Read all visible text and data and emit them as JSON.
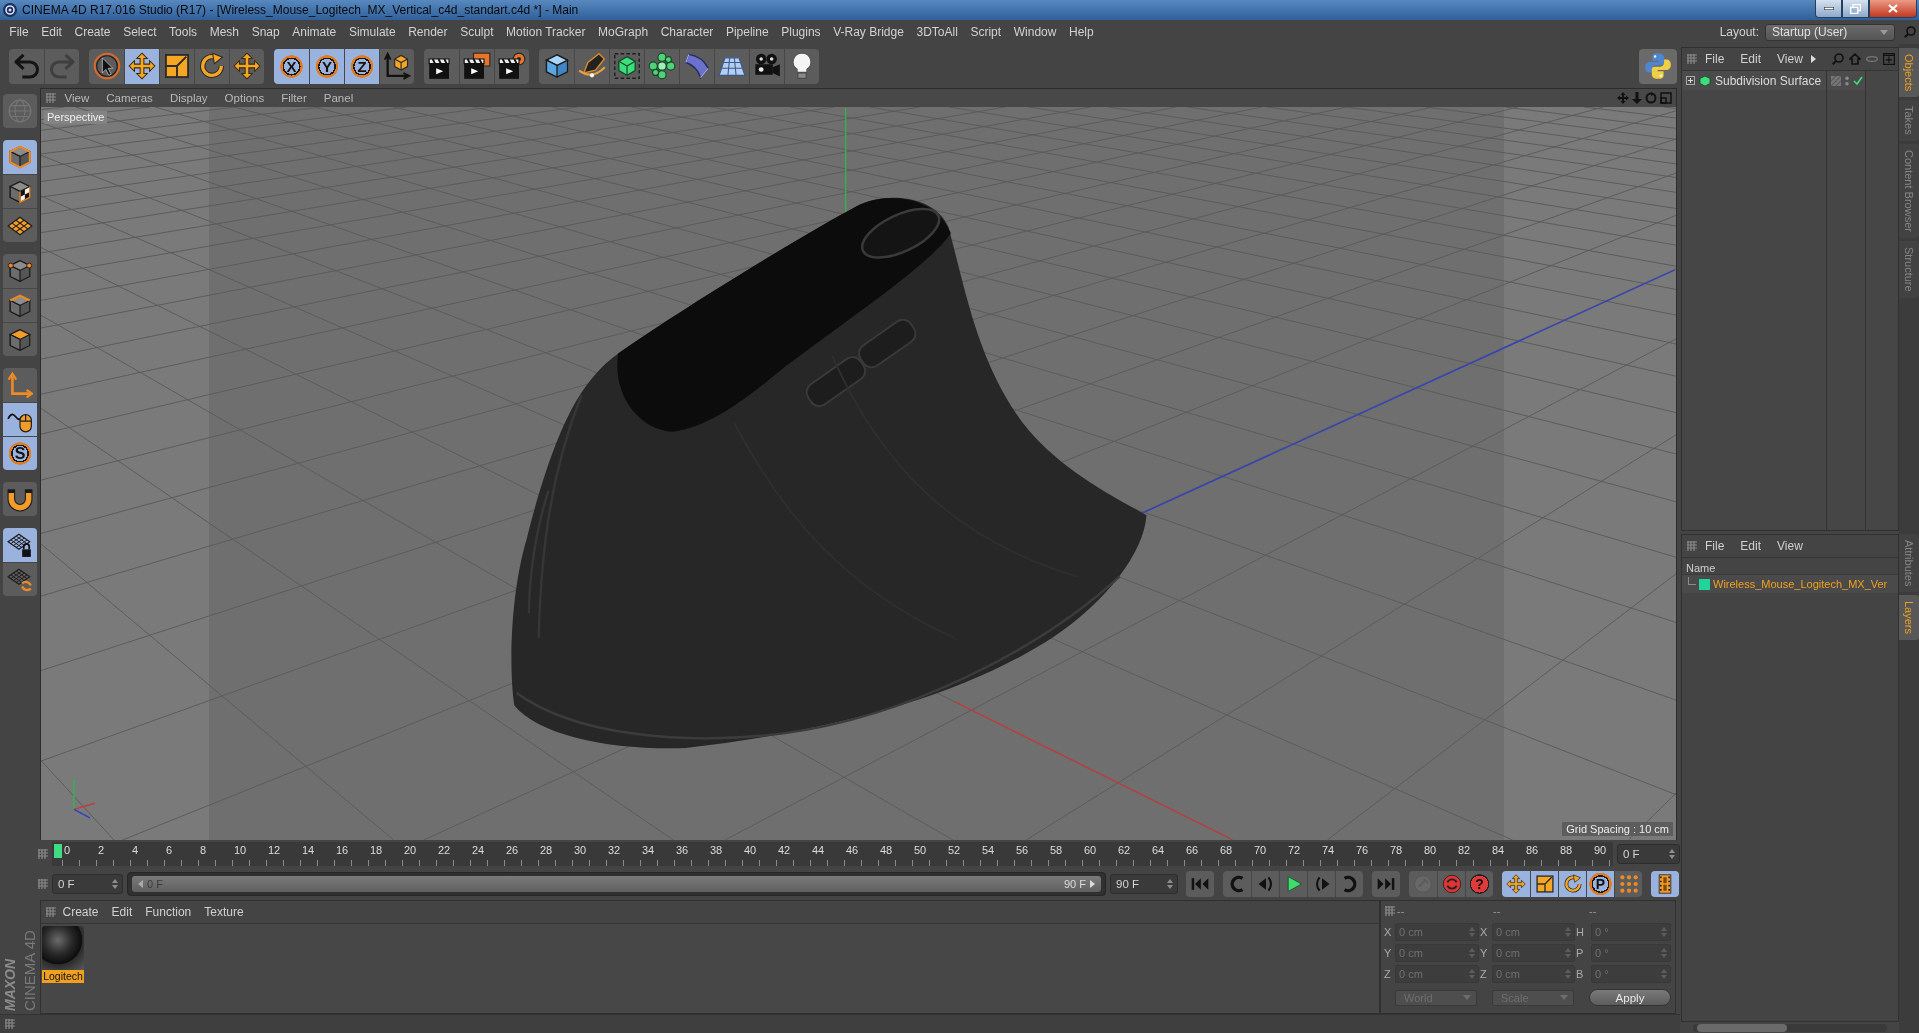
{
  "window": {
    "title": "CINEMA 4D R17.016 Studio (R17) - [Wireless_Mouse_Logitech_MX_Vertical_c4d_standart.c4d *] - Main"
  },
  "menu_bar": {
    "items": [
      "File",
      "Edit",
      "Create",
      "Select",
      "Tools",
      "Mesh",
      "Snap",
      "Animate",
      "Simulate",
      "Render",
      "Sculpt",
      "Motion Tracker",
      "MoGraph",
      "Character",
      "Pipeline",
      "Plugins",
      "V-Ray Bridge",
      "3DToAll",
      "Script",
      "Window",
      "Help"
    ],
    "layout_label": "Layout:",
    "layout_value": "Startup (User)"
  },
  "toolbar": {
    "groups": [
      [
        {
          "kind": "undo",
          "selected": false,
          "disabled": false
        },
        {
          "kind": "redo",
          "selected": false,
          "disabled": true
        }
      ],
      [
        {
          "kind": "live-select",
          "selected": false,
          "disabled": false
        },
        {
          "kind": "move",
          "selected": true,
          "disabled": false
        },
        {
          "kind": "scale",
          "selected": false,
          "disabled": false
        },
        {
          "kind": "rotate",
          "selected": false,
          "disabled": false
        },
        {
          "kind": "last-tool",
          "selected": false,
          "disabled": false
        }
      ],
      [
        {
          "kind": "axis-lock",
          "label": "X",
          "selected": true,
          "disabled": false
        },
        {
          "kind": "axis-lock",
          "label": "Y",
          "selected": true,
          "disabled": false
        },
        {
          "kind": "axis-lock",
          "label": "Z",
          "selected": true,
          "disabled": false
        },
        {
          "kind": "coord-system",
          "selected": false,
          "disabled": false
        }
      ],
      [
        {
          "kind": "render-view",
          "selected": false,
          "disabled": false
        },
        {
          "kind": "render-pv",
          "selected": false,
          "disabled": false
        },
        {
          "kind": "render-settings",
          "selected": false,
          "disabled": false
        }
      ],
      [
        {
          "kind": "cube",
          "selected": false,
          "disabled": false
        },
        {
          "kind": "pen",
          "selected": false,
          "disabled": false
        },
        {
          "kind": "subdivision",
          "selected": false,
          "disabled": false
        },
        {
          "kind": "cloner",
          "selected": false,
          "disabled": false
        },
        {
          "kind": "bend",
          "selected": false,
          "disabled": false
        },
        {
          "kind": "floor",
          "selected": false,
          "disabled": false
        },
        {
          "kind": "camera",
          "selected": false,
          "disabled": false
        },
        {
          "kind": "light",
          "selected": false,
          "disabled": false
        }
      ]
    ],
    "python": {
      "kind": "python",
      "selected": false
    }
  },
  "left_palette": {
    "groups": [
      [
        {
          "kind": "make-editable",
          "selected": false,
          "disabled": true
        }
      ],
      [
        {
          "kind": "model",
          "selected": true,
          "disabled": false
        },
        {
          "kind": "texture",
          "selected": false,
          "disabled": false
        },
        {
          "kind": "workplane",
          "selected": false,
          "disabled": false
        }
      ],
      [
        {
          "kind": "points",
          "selected": false,
          "disabled": false
        },
        {
          "kind": "edges",
          "selected": false,
          "disabled": false
        },
        {
          "kind": "polygons",
          "selected": false,
          "disabled": false
        }
      ],
      [
        {
          "kind": "axis",
          "selected": false,
          "disabled": false
        },
        {
          "kind": "tweak",
          "selected": true,
          "disabled": false
        },
        {
          "kind": "solo",
          "label": "S",
          "selected": true,
          "disabled": false
        }
      ],
      [
        {
          "kind": "snap",
          "selected": false,
          "disabled": false
        }
      ],
      [
        {
          "kind": "lock-workplane",
          "selected": true,
          "disabled": false
        },
        {
          "kind": "planar-workplane",
          "selected": false,
          "disabled": false
        }
      ]
    ]
  },
  "viewport": {
    "menu": [
      "View",
      "Cameras",
      "Display",
      "Options",
      "Filter",
      "Panel"
    ],
    "camera_label": "Perspective",
    "grid_spacing": "Grid Spacing : 10 cm"
  },
  "timeline": {
    "ticks": [
      "0",
      "2",
      "4",
      "6",
      "8",
      "10",
      "12",
      "14",
      "16",
      "18",
      "20",
      "22",
      "24",
      "26",
      "28",
      "30",
      "32",
      "34",
      "36",
      "38",
      "40",
      "42",
      "44",
      "46",
      "48",
      "50",
      "52",
      "54",
      "56",
      "58",
      "60",
      "62",
      "64",
      "66",
      "68",
      "70",
      "72",
      "74",
      "76",
      "78",
      "80",
      "82",
      "84",
      "86",
      "88",
      "90"
    ],
    "playhead": {
      "level": 0
    },
    "current_frame": "0 F"
  },
  "transport": {
    "start_field": "0 F",
    "range": {
      "level": 1,
      "start_label": "0 F",
      "end_label": "90 F"
    },
    "end_field": "90 F",
    "groups": [
      [
        {
          "kind": "go-start",
          "selected": false,
          "disabled": false
        }
      ],
      [
        {
          "kind": "prev-key",
          "selected": false,
          "disabled": false
        },
        {
          "kind": "prev-frame",
          "selected": false,
          "disabled": false
        },
        {
          "kind": "play",
          "selected": false,
          "disabled": false
        },
        {
          "kind": "next-frame",
          "selected": false,
          "disabled": false
        },
        {
          "kind": "next-key",
          "selected": false,
          "disabled": false
        }
      ],
      [
        {
          "kind": "go-end",
          "selected": false,
          "disabled": false
        }
      ],
      [
        {
          "kind": "record",
          "selected": false,
          "disabled": true
        },
        {
          "kind": "autokey",
          "selected": false,
          "disabled": false
        },
        {
          "kind": "key-selection",
          "label": "?",
          "selected": false,
          "disabled": false
        }
      ],
      [
        {
          "kind": "move",
          "selected": true,
          "disabled": false
        },
        {
          "kind": "scale",
          "selected": true,
          "disabled": false
        },
        {
          "kind": "rotate",
          "selected": true,
          "disabled": false
        },
        {
          "kind": "param",
          "label": "P",
          "selected": true,
          "disabled": false
        },
        {
          "kind": "pla",
          "selected": false,
          "disabled": false
        }
      ],
      [
        {
          "kind": "timeline",
          "selected": true,
          "disabled": false
        }
      ]
    ]
  },
  "logo": {
    "brand": "MAXON",
    "product": "CINEMA 4D"
  },
  "material_manager": {
    "menu": [
      "Create",
      "Edit",
      "Function",
      "Texture"
    ],
    "materials": [
      {
        "name": "Logitech",
        "selected": true
      }
    ]
  },
  "coordinates": {
    "headers": [
      "--",
      "--",
      "--"
    ],
    "disabled": true,
    "rows": [
      {
        "cells": [
          {
            "label": "X",
            "value": "0 cm"
          },
          {
            "label": "X",
            "value": "0 cm"
          },
          {
            "label": "H",
            "value": "0 °"
          }
        ]
      },
      {
        "cells": [
          {
            "label": "Y",
            "value": "0 cm"
          },
          {
            "label": "Y",
            "value": "0 cm"
          },
          {
            "label": "P",
            "value": "0 °"
          }
        ]
      },
      {
        "cells": [
          {
            "label": "Z",
            "value": "0 cm"
          },
          {
            "label": "Z",
            "value": "0 cm"
          },
          {
            "label": "B",
            "value": "0 °"
          }
        ]
      }
    ],
    "dropdowns": [
      "World",
      "Scale"
    ],
    "apply": "Apply"
  },
  "objects_manager": {
    "menu": [
      "File",
      "Edit",
      "View"
    ],
    "objects": [
      {
        "name": "Subdivision Surface",
        "expanded": false,
        "selected": false,
        "enabled": true
      }
    ]
  },
  "layers_manager": {
    "menu": [
      "File",
      "Edit",
      "View"
    ],
    "column": "Name",
    "layers": [
      {
        "name": "Wireless_Mouse_Logitech_MX_Ver",
        "color": "#22d39a",
        "selected": true
      }
    ]
  },
  "side_tabs": {
    "top": [
      {
        "label": "Objects",
        "selected": true
      },
      {
        "label": "Takes",
        "selected": false
      },
      {
        "label": "Content Browser",
        "selected": false
      },
      {
        "label": "Structure",
        "selected": false
      }
    ],
    "bottom": [
      {
        "label": "Attributes",
        "selected": false
      },
      {
        "label": "Layers",
        "selected": true
      }
    ]
  }
}
